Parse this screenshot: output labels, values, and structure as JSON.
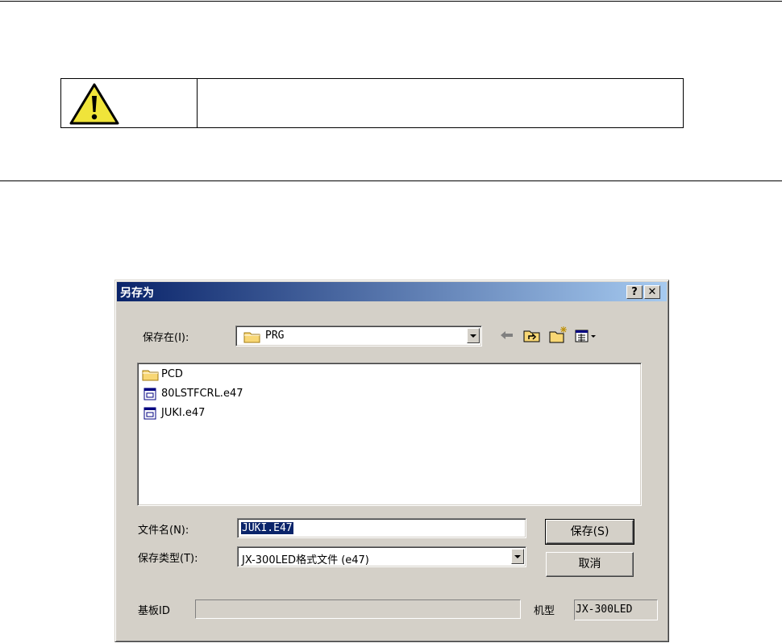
{
  "dialog": {
    "title": "另存为",
    "help_label": "?",
    "close_label": "✕",
    "save_in_label": "保存在(I):",
    "save_in_value": "PRG",
    "toolbar_icons": [
      "back-arrow-icon",
      "up-folder-icon",
      "new-folder-icon",
      "view-menu-icon"
    ],
    "files": [
      {
        "name": "PCD",
        "icon": "folder-icon"
      },
      {
        "name": "80LSTFCRL.e47",
        "icon": "document-icon"
      },
      {
        "name": "JUKI.e47",
        "icon": "document-icon"
      }
    ],
    "filename_label": "文件名(N):",
    "filename_value": "JUKI.E47",
    "filetype_label": "保存类型(T):",
    "filetype_value": "JX-300LED格式文件 (e47)",
    "save_button": "保存(S)",
    "cancel_button": "取消",
    "board_id_label": "基板ID",
    "board_id_value": "",
    "model_label": "机型",
    "model_value": "JX-300LED"
  },
  "colors": {
    "title_start": "#0a246a",
    "title_end": "#a6caf0",
    "dialog_face": "#d4d0c8",
    "warning_yellow": "#f0e43a"
  }
}
